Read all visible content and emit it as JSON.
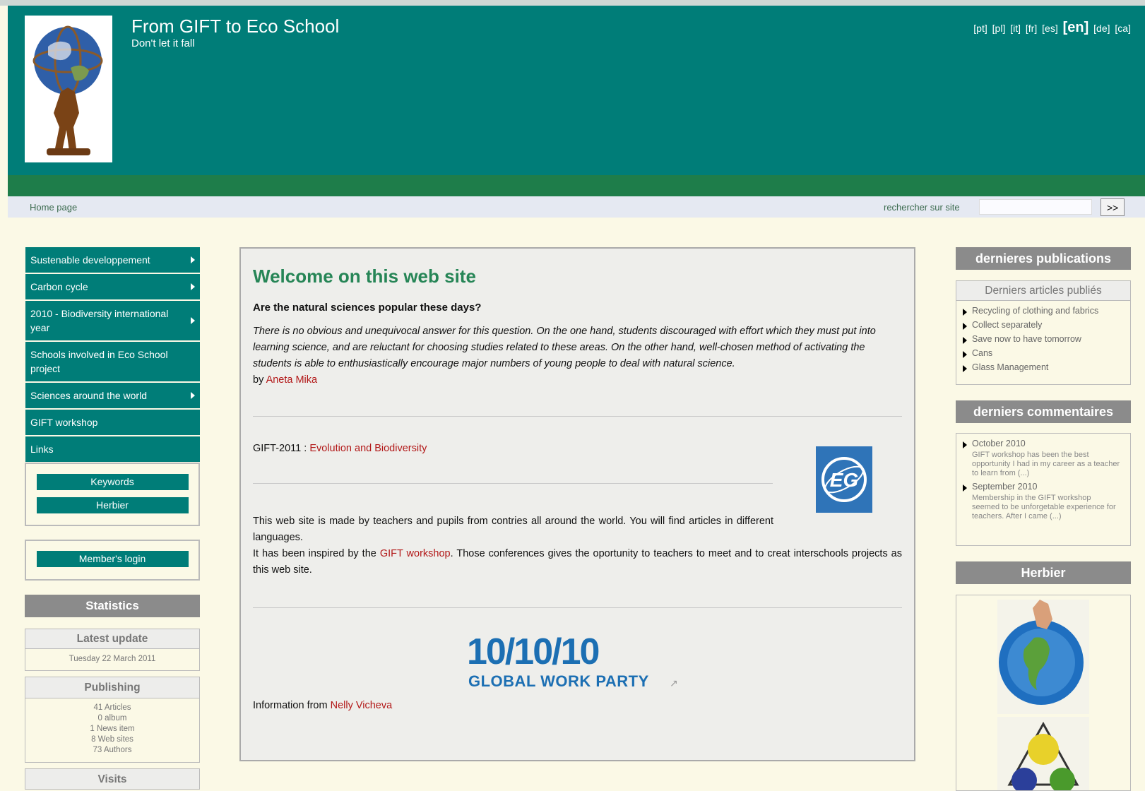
{
  "site": {
    "title": "From GIFT to Eco School",
    "slogan": "Don't let it fall"
  },
  "languages": [
    {
      "code": "[pt]",
      "active": false
    },
    {
      "code": "[pl]",
      "active": false
    },
    {
      "code": "[it]",
      "active": false
    },
    {
      "code": "[fr]",
      "active": false
    },
    {
      "code": "[es]",
      "active": false
    },
    {
      "code": "[en]",
      "active": true
    },
    {
      "code": "[de]",
      "active": false
    },
    {
      "code": "[ca]",
      "active": false
    }
  ],
  "navbar": {
    "home": "Home page",
    "search_label": "rechercher sur site",
    "search_value": "",
    "search_button": ">>"
  },
  "menu": [
    {
      "label": "Sustenable developpement",
      "has_sub": true
    },
    {
      "label": "Carbon cycle",
      "has_sub": true
    },
    {
      "label": "2010 - Biodiversity international year",
      "has_sub": true
    },
    {
      "label": "Schools involved in Eco School project",
      "has_sub": false
    },
    {
      "label": "Sciences around the world",
      "has_sub": true
    },
    {
      "label": "GIFT workshop",
      "has_sub": false
    },
    {
      "label": "Links",
      "has_sub": false
    }
  ],
  "buttons": {
    "keywords": "Keywords",
    "herbier": "Herbier",
    "member_login": "Member's login"
  },
  "stats": {
    "title": "Statistics",
    "latest_update_title": "Latest update",
    "latest_update_value": "Tuesday 22 March 2011",
    "publishing_title": "Publishing",
    "articles": "41 Articles",
    "album": "0 album",
    "news": "1 News item",
    "websites": "8 Web sites",
    "authors": "73 Authors",
    "visits_title": "Visits"
  },
  "main": {
    "title": "Welcome on this web site",
    "question": "Are the natural sciences popular these days?",
    "intro": "There is no obvious and unequivocal answer for this question. On the one hand, students discouraged with effort which they must put into learning science, and are reluctant for choosing studies related to these areas. On the other hand, well-chosen method of activating the students is able to enthusiastically encourage major numbers of young people to deal with natural science.",
    "by_prefix": "by",
    "by_author": "Aneta Mika",
    "gift_prefix": "GIFT-2011 :",
    "gift_link": "Evolution and Biodiversity",
    "egu_logo_text": "EG",
    "para1": "This web site is made by teachers and pupils from contries all around the world. You will find articles in different languages.",
    "para2_a": "It has been inspired by the",
    "para2_link": "GIFT workshop",
    "para2_b": ". Those conferences gives the oportunity to teachers to meet and to creat interschools projects as this web site.",
    "banner_numbers": "10/10/10",
    "banner_text": "GLOBAL WORK PARTY",
    "info_prefix": "Information from",
    "info_author": "Nelly Vicheva"
  },
  "right": {
    "pub_title": "dernieres publications",
    "pub_sub": "Derniers articles publiés",
    "articles": [
      "Recycling of clothing and fabrics",
      "Collect separately",
      "Save now to have tomorrow",
      "Cans",
      "Glass Management"
    ],
    "comments_title": "derniers commentaires",
    "comments": [
      {
        "date": "October 2010",
        "text": "GIFT workshop has been the best opportunity I had in my career as a teacher to learn from (...)"
      },
      {
        "date": "September 2010",
        "text": "Membership in the GIFT workshop seemed to be unforgetable experience for teachers. After I came (...)"
      }
    ],
    "herbier_title": "Herbier"
  },
  "colors": {
    "header": "#007d78",
    "band": "#1e7d4a",
    "menu": "#007d78",
    "title_green": "#268556",
    "link_red": "#b21818",
    "panel_gray": "#8b8b8b"
  }
}
